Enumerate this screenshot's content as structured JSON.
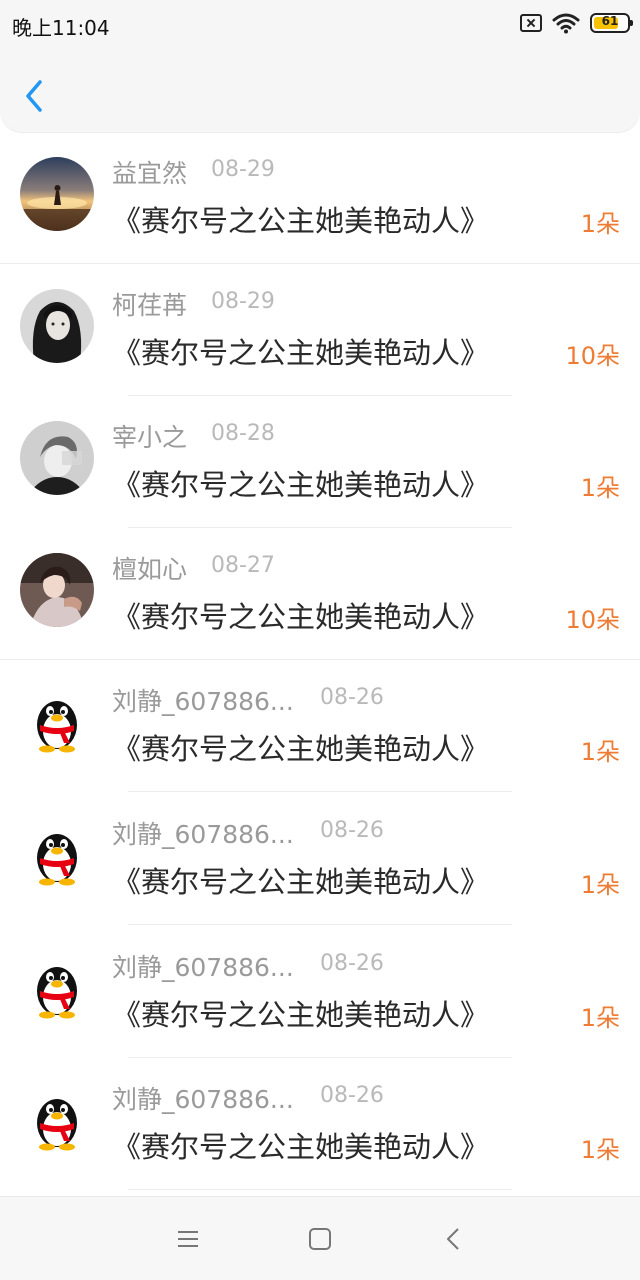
{
  "status_bar": {
    "time": "晚上11:04",
    "battery": "61",
    "icons": [
      "sim-off-icon",
      "wifi-icon",
      "battery-icon"
    ]
  },
  "header": {
    "back_icon": "chevron-left-icon",
    "accent_color": "#2196f3"
  },
  "list": {
    "items": [
      {
        "name": "益宜然",
        "date": "08-29",
        "gift": "《赛尔号之公主她美艳动人》",
        "count": "1朵",
        "avatar": "sunset-photo"
      },
      {
        "name": "柯荏苒",
        "date": "08-29",
        "gift": "《赛尔号之公主她美艳动人》",
        "count": "10朵",
        "avatar": "bw-portrait"
      },
      {
        "name": "宰小之",
        "date": "08-28",
        "gift": "《赛尔号之公主她美艳动人》",
        "count": "1朵",
        "avatar": "gray-portrait"
      },
      {
        "name": "檀如心",
        "date": "08-27",
        "gift": "《赛尔号之公主她美艳动人》",
        "count": "10朵",
        "avatar": "color-portrait"
      },
      {
        "name": "刘静_607886...",
        "date": "08-26",
        "gift": "《赛尔号之公主她美艳动人》",
        "count": "1朵",
        "avatar": "penguin"
      },
      {
        "name": "刘静_607886...",
        "date": "08-26",
        "gift": "《赛尔号之公主她美艳动人》",
        "count": "1朵",
        "avatar": "penguin"
      },
      {
        "name": "刘静_607886...",
        "date": "08-26",
        "gift": "《赛尔号之公主她美艳动人》",
        "count": "1朵",
        "avatar": "penguin"
      },
      {
        "name": "刘静_607886...",
        "date": "08-26",
        "gift": "《赛尔号之公主她美艳动人》",
        "count": "1朵",
        "avatar": "penguin"
      }
    ]
  },
  "colors": {
    "count": "#ef7c35",
    "name": "#9a9a9a",
    "date": "#b9b9b9",
    "title_text": "#2a2a2a"
  },
  "nav_bar": {
    "icons": [
      "menu-icon",
      "home-square-icon",
      "back-triangle-icon"
    ]
  }
}
